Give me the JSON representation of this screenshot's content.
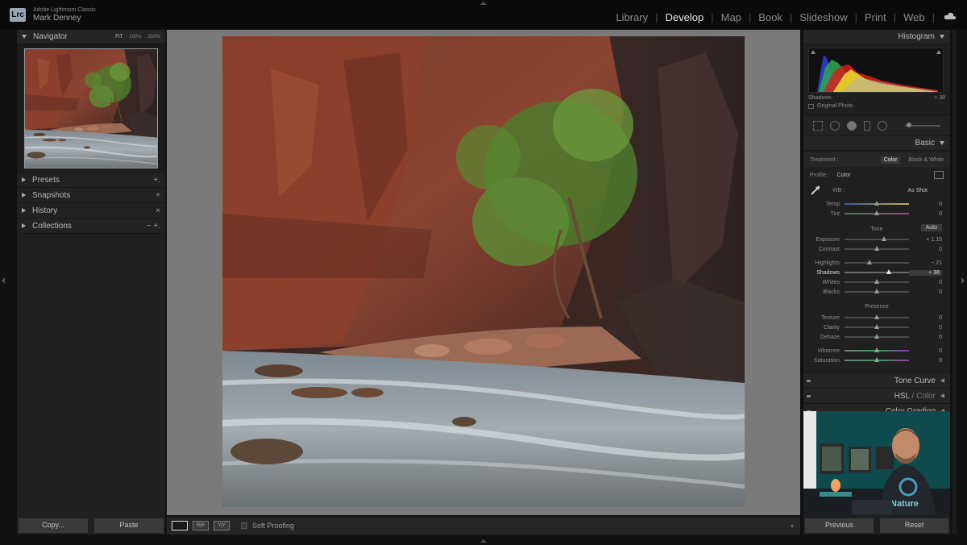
{
  "app": {
    "logo_text": "Lrc",
    "app_name": "Adobe Lightroom Classic",
    "user_name": "Mark Denney"
  },
  "modules": [
    {
      "label": "Library",
      "active": false
    },
    {
      "label": "Develop",
      "active": true
    },
    {
      "label": "Map",
      "active": false
    },
    {
      "label": "Book",
      "active": false
    },
    {
      "label": "Slideshow",
      "active": false
    },
    {
      "label": "Print",
      "active": false
    },
    {
      "label": "Web",
      "active": false
    }
  ],
  "left": {
    "navigator": {
      "title": "Navigator",
      "zooms": [
        "FIT",
        "100%",
        "200%"
      ]
    },
    "sections": [
      {
        "label": "Presets",
        "action": "+."
      },
      {
        "label": "Snapshots",
        "action": "+"
      },
      {
        "label": "History",
        "action": "×"
      },
      {
        "label": "Collections",
        "action": "− +."
      }
    ],
    "copy_label": "Copy...",
    "paste_label": "Paste"
  },
  "toolbar": {
    "soft_proofing_label": "Soft Proofing"
  },
  "right": {
    "histogram": {
      "title": "Histogram",
      "readout_label": "Shadows",
      "readout_value": "+ 38",
      "original_photo_label": "Original Photo"
    },
    "basic": {
      "title": "Basic",
      "treatment_label": "Treatment :",
      "treatment_options": [
        "Color",
        "Black & White"
      ],
      "profile_label": "Profile :",
      "profile_value": "Color",
      "wb_label": "WB :",
      "wb_value": "As Shot",
      "temp": {
        "label": "Temp",
        "value": "0",
        "position": 0.5
      },
      "tint": {
        "label": "Tint",
        "value": "0",
        "position": 0.5
      },
      "tone_label": "Tone",
      "auto_label": "Auto",
      "exposure": {
        "label": "Exposure",
        "value": "+ 1.15",
        "position": 0.61
      },
      "contrast": {
        "label": "Contrast",
        "value": "0",
        "position": 0.5
      },
      "highlights": {
        "label": "Highlights",
        "value": "− 21",
        "position": 0.39
      },
      "shadows": {
        "label": "Shadows",
        "value": "+ 38",
        "position": 0.69
      },
      "whites": {
        "label": "Whites",
        "value": "0",
        "position": 0.5
      },
      "blacks": {
        "label": "Blacks",
        "value": "0",
        "position": 0.5
      },
      "presence_label": "Presence",
      "texture": {
        "label": "Texture",
        "value": "0",
        "position": 0.5
      },
      "clarity": {
        "label": "Clarity",
        "value": "0",
        "position": 0.5
      },
      "dehaze": {
        "label": "Dehaze",
        "value": "0",
        "position": 0.5
      },
      "vibrance": {
        "label": "Vibrance",
        "value": "0",
        "position": 0.5
      },
      "saturation": {
        "label": "Saturation",
        "value": "0",
        "position": 0.5
      }
    },
    "tone_curve": "Tone Curve",
    "hsl": "HSL",
    "hsl_color": "Color",
    "color_grading": "Color Grading",
    "webcam_shirt_text": "Nature",
    "previous_label": "Previous",
    "reset_label": "Reset"
  },
  "colors": {
    "background": "#0b0b0b",
    "panel": "#202020",
    "center_bg": "#7a7a7a"
  }
}
